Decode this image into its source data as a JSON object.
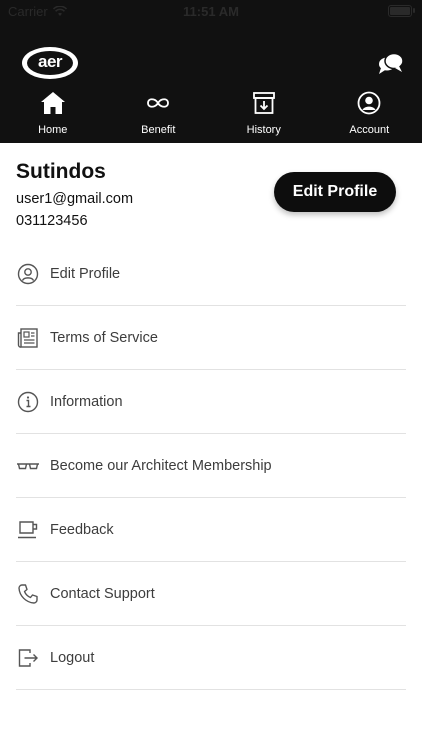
{
  "status_bar": {
    "carrier": "Carrier",
    "time": "11:51 AM"
  },
  "header": {
    "logo_text": "aer",
    "nav": [
      {
        "label": "Home",
        "icon": "home-icon"
      },
      {
        "label": "Benefit",
        "icon": "infinity-icon"
      },
      {
        "label": "History",
        "icon": "archive-icon"
      },
      {
        "label": "Account",
        "icon": "account-icon"
      }
    ]
  },
  "profile": {
    "name": "Sutindos",
    "email": "user1@gmail.com",
    "phone": "031123456",
    "edit_button": "Edit Profile"
  },
  "menu": [
    {
      "label": "Edit Profile",
      "icon": "user-circle-icon"
    },
    {
      "label": "Terms of Service",
      "icon": "newspaper-icon"
    },
    {
      "label": "Information",
      "icon": "info-icon"
    },
    {
      "label": "Become our Architect Membership",
      "icon": "glasses-icon"
    },
    {
      "label": "Feedback",
      "icon": "cup-icon"
    },
    {
      "label": "Contact Support",
      "icon": "phone-icon"
    },
    {
      "label": "Logout",
      "icon": "logout-icon"
    }
  ],
  "colors": {
    "header_bg": "#111111",
    "button_bg": "#0d0d0d",
    "divider": "#e2e2e2"
  }
}
